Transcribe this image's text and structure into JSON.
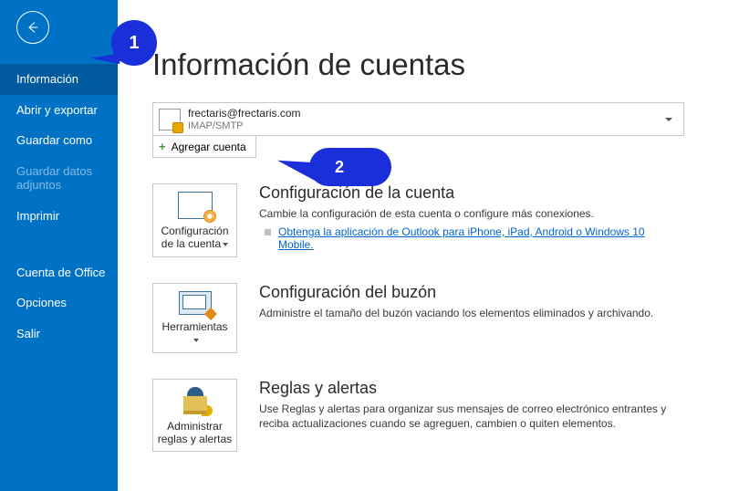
{
  "sidebar": {
    "items": [
      {
        "label": "Información",
        "state": "active"
      },
      {
        "label": "Abrir y exportar",
        "state": ""
      },
      {
        "label": "Guardar como",
        "state": ""
      },
      {
        "label": "Guardar datos adjuntos",
        "state": "disabled"
      },
      {
        "label": "Imprimir",
        "state": ""
      }
    ],
    "group2": [
      {
        "label": "Cuenta de Office"
      },
      {
        "label": "Opciones"
      },
      {
        "label": "Salir"
      }
    ]
  },
  "page_title": "Información de cuentas",
  "account": {
    "email": "frectaris@frectaris.com",
    "type": "IMAP/SMTP"
  },
  "add_account_label": "Agregar cuenta",
  "sections": [
    {
      "tile_label": "Configuración de la cuenta",
      "title": "Configuración de la cuenta",
      "desc": "Cambie la configuración de esta cuenta o configure más conexiones.",
      "link": "Obtenga la aplicación de Outlook para iPhone, iPad, Android o Windows 10 Mobile."
    },
    {
      "tile_label": "Herramientas",
      "title": "Configuración del buzón",
      "desc": "Administre el tamaño del buzón vaciando los elementos eliminados y archivando."
    },
    {
      "tile_label": "Administrar reglas y alertas",
      "title": "Reglas y alertas",
      "desc": "Use Reglas y alertas para organizar sus mensajes de correo electrónico entrantes y reciba actualizaciones cuando se agreguen, cambien o quiten elementos."
    }
  ],
  "callouts": {
    "c1": "1",
    "c2": "2"
  }
}
